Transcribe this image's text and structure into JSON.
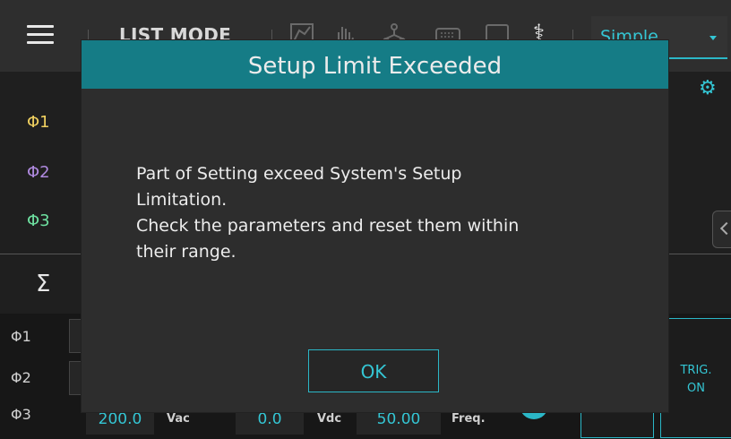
{
  "topbar": {
    "mode_label": "LIST MODE",
    "display_select": {
      "value": "Simple"
    },
    "icons": [
      "menu-icon",
      "waveform-icon",
      "hand-gesture-icon",
      "network-icon",
      "keyboard-icon",
      "monitor-icon",
      "usb-icon"
    ]
  },
  "phases": {
    "p1": "Φ1",
    "p2": "Φ2",
    "p3": "Φ3",
    "sum": "Σ"
  },
  "bottom": {
    "labels": {
      "p1": "Φ1",
      "p2": "Φ2",
      "p3": "Φ3"
    },
    "row3": {
      "vac_value": "200.0",
      "vac_unit": "Vac",
      "vdc_value": "0.0",
      "vdc_unit": "Vdc",
      "freq_value": "50.00",
      "freq_unit": "Freq."
    },
    "trig_label_line1": "TRIG.",
    "trig_label_line2": "ON"
  },
  "dialog": {
    "title": "Setup Limit Exceeded",
    "message_lines": [
      "Part of Setting exceed System's Setup",
      "Limitation.",
      "Check the parameters and reset them within",
      "their range."
    ],
    "ok_label": "OK"
  },
  "colors": {
    "accent": "#2bb7c7",
    "title_bar": "#157c86",
    "phase1": "#f0d060",
    "phase2": "#b08ae0",
    "phase3": "#6ee0a0"
  }
}
